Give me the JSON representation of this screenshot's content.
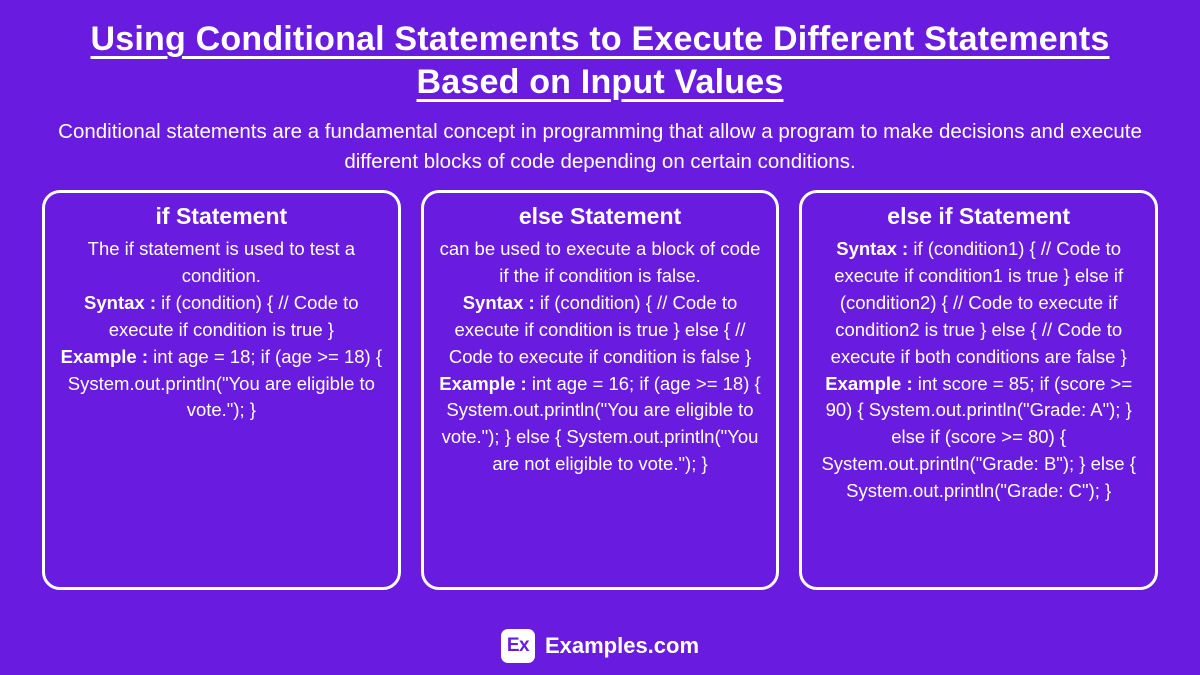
{
  "title": "Using Conditional Statements to Execute Different Statements Based on Input Values",
  "intro": "Conditional statements are a fundamental concept in programming that allow a program to make decisions and execute different blocks of code depending on certain conditions.",
  "cards": [
    {
      "title": "if Statement",
      "desc": "The if statement is used to test a condition.",
      "syntax_label": "Syntax :",
      "syntax": " if (condition) { // Code to execute if condition is true\n}",
      "example_label": "Example :",
      "example": " int age = 18; if (age >= 18) {\nSystem.out.println(\"You are eligible to vote.\");\n}"
    },
    {
      "title": "else Statement",
      "desc": "can be used to execute a block of code if the if condition is false.",
      "syntax_label": "Syntax :",
      "syntax": " if (condition) { // Code to execute if condition is true } else { // Code to execute if condition is false }",
      "example_label": "Example :",
      "example": " int age = 16; if (age >= 18) { System.out.println(\"You are eligible to vote.\"); } else { System.out.println(\"You are not eligible to vote.\"); }"
    },
    {
      "title": "else if Statement",
      "desc": "",
      "syntax_label": "Syntax :",
      "syntax": " if (condition1) { // Code to execute if condition1 is true } else if (condition2) { // Code to execute if condition2 is true } else { // Code to execute if both conditions are false }",
      "example_label": "Example :",
      "example": " int score = 85; if (score >= 90) { System.out.println(\"Grade: A\"); } else if (score >= 80) { System.out.println(\"Grade: B\"); } else { System.out.println(\"Grade: C\"); }"
    }
  ],
  "footer": {
    "logo_text": "Ex",
    "brand": "Examples.com"
  }
}
